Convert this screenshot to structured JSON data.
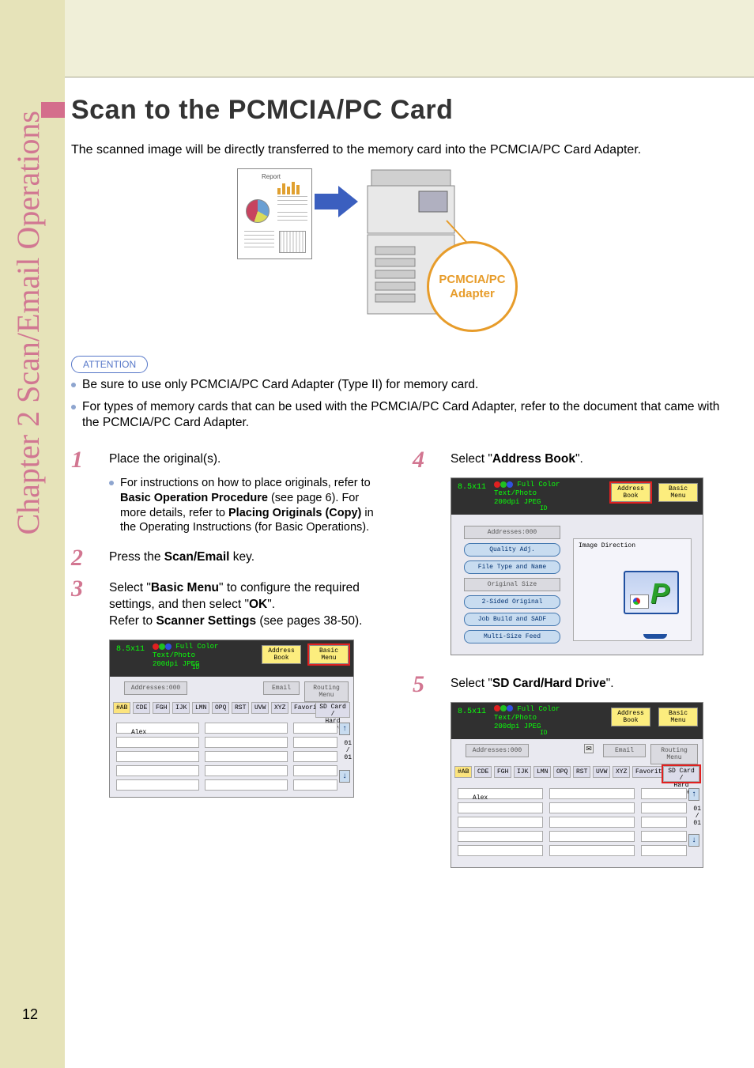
{
  "chapter_label": "Chapter 2  Scan/Email Operations",
  "page_number": "12",
  "title": "Scan to the PCMCIA/PC Card",
  "intro": "The scanned image will be directly transferred to the memory card into the PCMCIA/PC Card Adapter.",
  "figure": {
    "doc_header": "Report",
    "adapter_label": "PCMCIA/PC\nAdapter"
  },
  "attention_label": "ATTENTION",
  "attention_bullets": [
    "Be sure to use only PCMCIA/PC Card Adapter (Type II) for memory card.",
    "For types of memory cards that can be used with the PCMCIA/PC Card Adapter, refer to the document that came with the PCMCIA/PC Card Adapter."
  ],
  "left_steps": [
    {
      "num": "1",
      "body_segments": [
        {
          "text": "Place the original(s)."
        }
      ],
      "sub_segments": [
        {
          "text": "For instructions on how to place originals, refer to "
        },
        {
          "text": "Basic Operation Procedure",
          "bold": true
        },
        {
          "text": " (see page 6). For more details, refer to "
        },
        {
          "text": "Placing Originals (Copy)",
          "bold": true
        },
        {
          "text": " in the Operating Instructions (for Basic Operations)."
        }
      ]
    },
    {
      "num": "2",
      "body_segments": [
        {
          "text": "Press the "
        },
        {
          "text": "Scan/Email",
          "bold": true
        },
        {
          "text": " key."
        }
      ]
    },
    {
      "num": "3",
      "body_segments": [
        {
          "text": "Select \""
        },
        {
          "text": "Basic Menu",
          "bold": true
        },
        {
          "text": "\" to configure the required settings, and then select \""
        },
        {
          "text": "OK",
          "bold": true
        },
        {
          "text": "\".\nRefer to "
        },
        {
          "text": "Scanner Settings",
          "bold": true
        },
        {
          "text": " (see pages 38-50)."
        }
      ]
    }
  ],
  "right_steps": [
    {
      "num": "4",
      "body_segments": [
        {
          "text": "Select \""
        },
        {
          "text": "Address Book",
          "bold": true
        },
        {
          "text": "\"."
        }
      ]
    },
    {
      "num": "5",
      "body_segments": [
        {
          "text": "Select \""
        },
        {
          "text": "SD Card/Hard Drive",
          "bold": true
        },
        {
          "text": "\"."
        }
      ]
    }
  ],
  "ui": {
    "size": "8.5x11",
    "full_color": "Full Color",
    "text_photo": "Text/Photo",
    "resolution": "200dpi JPEG",
    "id": "ID",
    "address_book": "Address Book",
    "basic_menu": "Basic Menu",
    "addresses": "Addresses:000",
    "email": "Email",
    "routing": "Routing Menu",
    "tabs": [
      "#AB",
      "CDE",
      "FGH",
      "IJK",
      "LMN",
      "OPQ",
      "RST",
      "UVW",
      "XYZ",
      "Favorites"
    ],
    "sd_hard": "SD Card /\nHard Drive",
    "alex": "Alex",
    "pager": "01\n/\n01",
    "image_direction": "Image Direction",
    "side_buttons": [
      "Addresses:000",
      "Quality Adj.",
      "File Type and Name",
      "Original Size",
      "2-Sided Original",
      "Job Build and SADF",
      "Multi-Size Feed"
    ]
  }
}
